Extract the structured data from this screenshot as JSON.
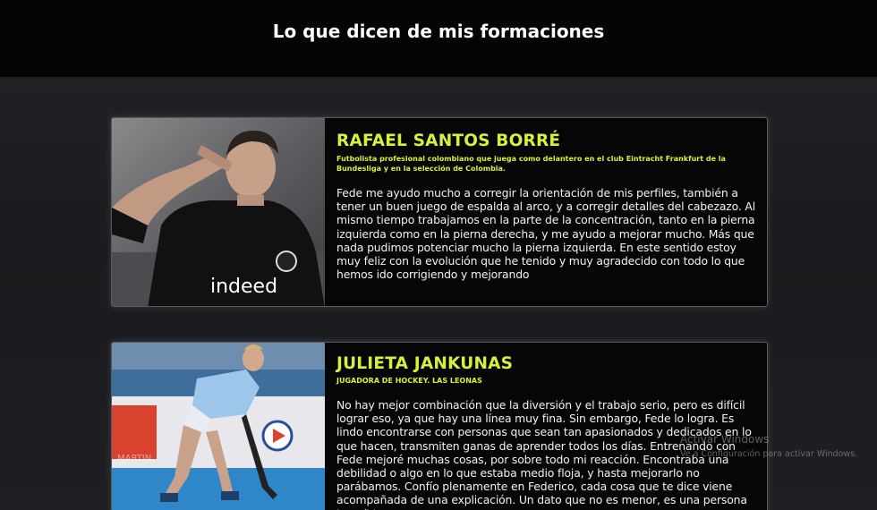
{
  "header": {
    "title": "Lo que dicen de mis formaciones"
  },
  "testimonials": [
    {
      "name": "RAFAEL SANTOS BORRÉ",
      "role": "Futbolista profesional colombiano que juega como delantero en el club Eintracht Frankfurt de la Bundesliga y en la selección de Colombia.",
      "quote": "Fede me ayudo mucho a corregir la orientación de mis perfiles, también a tener un buen juego de espalda al arco, y a corregir detalles del cabezazo. Al mismo tiempo trabajamos en la parte de la concentración, tanto en la pierna izquierda como en la pierna derecha, y me ayudo a mejorar mucho. Más que nada pudimos potenciar mucho la pierna izquierda. En este sentido estoy muy feliz con la evolución que he tenido y muy agradecido con todo lo que hemos ido corrigiendo y mejorando",
      "photo_text": "indeed"
    },
    {
      "name": "JULIETA JANKUNAS",
      "role": "JUGADORA DE HOCKEY. LAS LEONAS",
      "quote": "No hay mejor combinación que la diversión y el trabajo serio, pero es difícil lograr eso, ya que hay una línea muy fina. Sin embargo, Fede lo logra. Es lindo encontrarse con personas que sean tan apasionados y dedicados en lo que hacen, transmiten ganas de aprender todos los días. Entrenando con Fede mejoré muchas cosas, por sobre todo mi reacción. Encontraba una debilidad o algo en lo que estaba medio floja, y hasta mejorarlo no parábamos. Confío plenamente en Federico, cada cosa que te dice viene acompañada de una explicación. Un dato que no es menor, es una persona increíble.",
      "photo_text": "MARTIN"
    }
  ],
  "os_watermark": {
    "title": "Activar Windows",
    "subtitle": "Ve a Configuración para activar Windows."
  },
  "colors": {
    "accent": "#d4f23a",
    "header_bg": "#050505",
    "card_bg": "#060606"
  }
}
